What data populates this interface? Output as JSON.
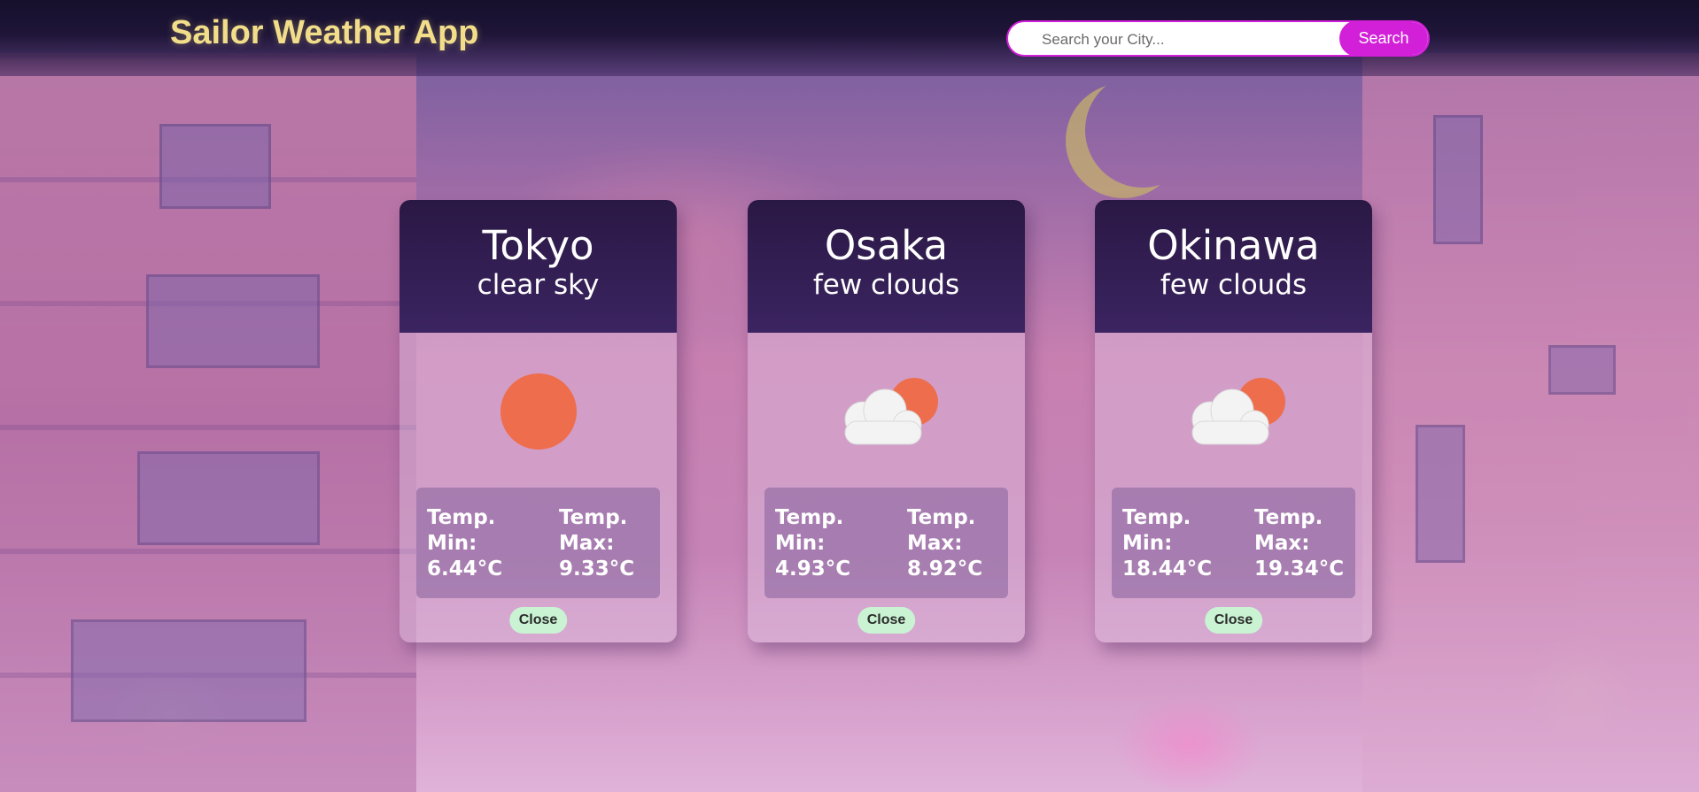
{
  "header": {
    "title": "Sailor Weather App",
    "search_placeholder": "Search your City...",
    "search_value": "",
    "search_label": "Search"
  },
  "cards": [
    {
      "city": "Tokyo",
      "description": "clear sky",
      "icon": "sun-icon",
      "min_label": "Temp. Min:",
      "min_value": "6.44°C",
      "max_label": "Temp. Max:",
      "max_value": "9.33°C",
      "close_label": "Close"
    },
    {
      "city": "Osaka",
      "description": "few clouds",
      "icon": "few-clouds-icon",
      "min_label": "Temp. Min:",
      "min_value": "4.93°C",
      "max_label": "Temp. Max:",
      "max_value": "8.92°C",
      "close_label": "Close"
    },
    {
      "city": "Okinawa",
      "description": "few clouds",
      "icon": "few-clouds-icon",
      "min_label": "Temp. Min:",
      "min_value": "18.44°C",
      "max_label": "Temp. Max:",
      "max_value": "19.34°C",
      "close_label": "Close"
    }
  ],
  "colors": {
    "title": "#f2de8a",
    "accent": "#d21fd8",
    "sun": "#ee6d4c",
    "close_button": "#c9f3d3"
  }
}
